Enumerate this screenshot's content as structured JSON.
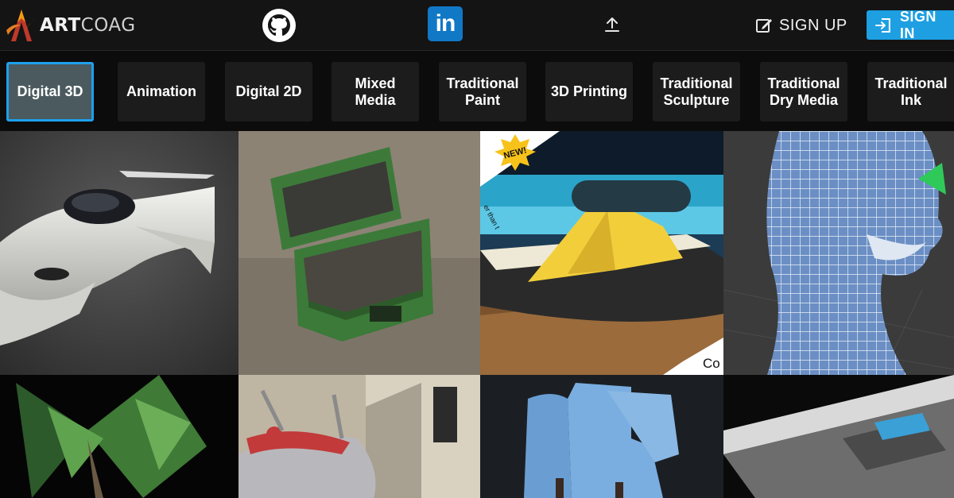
{
  "brand": {
    "name_bold": "ART",
    "name_light": "COAG",
    "logo_icon": "artcoag-logo-icon"
  },
  "header": {
    "github_icon": "github-icon",
    "linkedin_icon": "linkedin-icon",
    "linkedin_text": "in",
    "upload_icon": "upload-icon",
    "signup_label": "SIGN UP",
    "signin_label": "SIGN IN",
    "accent": "#1d9fe2"
  },
  "categories": [
    {
      "label": "Digital 3D",
      "active": true
    },
    {
      "label": "Animation"
    },
    {
      "label": "Digital 2D"
    },
    {
      "label": "Mixed Media"
    },
    {
      "label": "Traditional Paint"
    },
    {
      "label": "3D Printing"
    },
    {
      "label": "Traditional Sculpture"
    },
    {
      "label": "Traditional Dry Media"
    },
    {
      "label": "Traditional Ink"
    }
  ],
  "gallery": {
    "items": [
      {
        "subject": "white spaceship render"
      },
      {
        "subject": "green crate render"
      },
      {
        "subject": "yellow foot massager render",
        "badge": "NEW!",
        "side_text": "er than t",
        "corner_text": "Co"
      },
      {
        "subject": "wireframe head sculpt"
      },
      {
        "subject": "palm tree render"
      },
      {
        "subject": "hover bike render"
      },
      {
        "subject": "blue building render"
      },
      {
        "subject": "spaceship hull render"
      }
    ]
  }
}
